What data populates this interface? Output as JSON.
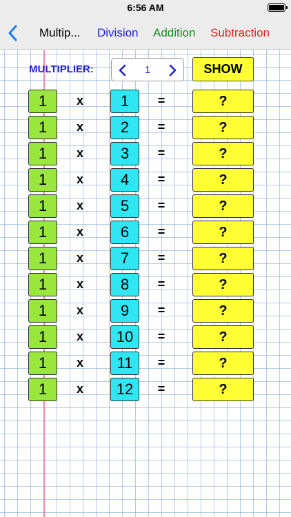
{
  "status": {
    "time": "6:56 AM"
  },
  "nav": {
    "title": "Multip...",
    "links": [
      {
        "id": "division",
        "label": "Division",
        "color": "#1f1fd8"
      },
      {
        "id": "addition",
        "label": "Addition",
        "color": "#1c8a1c"
      },
      {
        "id": "subtraction",
        "label": "Subtraction",
        "color": "#e01d1d"
      }
    ]
  },
  "controls": {
    "multiplier_label": "MULTIPLIER:",
    "multiplier_value": "1",
    "show_label": "SHOW"
  },
  "operators": {
    "times": "x",
    "equals": "="
  },
  "rows": [
    {
      "a": "1",
      "b": "1",
      "answer": "?"
    },
    {
      "a": "1",
      "b": "2",
      "answer": "?"
    },
    {
      "a": "1",
      "b": "3",
      "answer": "?"
    },
    {
      "a": "1",
      "b": "4",
      "answer": "?"
    },
    {
      "a": "1",
      "b": "5",
      "answer": "?"
    },
    {
      "a": "1",
      "b": "6",
      "answer": "?"
    },
    {
      "a": "1",
      "b": "7",
      "answer": "?"
    },
    {
      "a": "1",
      "b": "8",
      "answer": "?"
    },
    {
      "a": "1",
      "b": "9",
      "answer": "?"
    },
    {
      "a": "1",
      "b": "10",
      "answer": "?"
    },
    {
      "a": "1",
      "b": "11",
      "answer": "?"
    },
    {
      "a": "1",
      "b": "12",
      "answer": "?"
    }
  ],
  "colors": {
    "multiplicand_box": "#99e63c",
    "multiplier_box": "#2fe6f2",
    "answer_box": "#ffff33",
    "accent_blue": "#1f1fd8"
  },
  "icons": {
    "back": "chevron-left-icon",
    "decrement": "chevron-left-icon",
    "increment": "chevron-right-icon",
    "battery": "battery-icon"
  }
}
